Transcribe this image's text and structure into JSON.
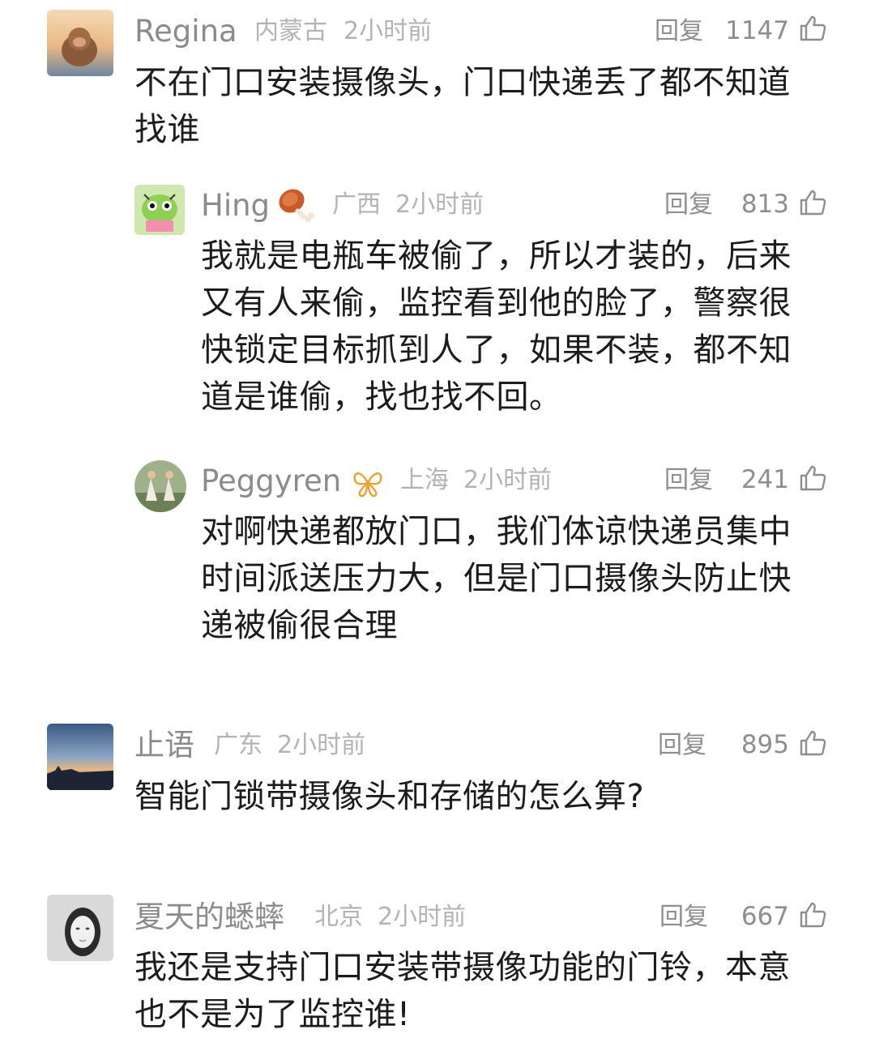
{
  "comments": [
    {
      "user": "Regina",
      "location": "内蒙古",
      "time": "2小时前",
      "reply_label": "回复",
      "likes": "1147",
      "text": "不在门口安装摄像头，门口快递丢了都不知道\n找谁",
      "avatar_icon": "photo-avatar-monkey"
    },
    {
      "user": "Hing",
      "location": "广西",
      "time": "2小时前",
      "reply_label": "回复",
      "likes": "813",
      "text": "我就是电瓶车被偷了，所以才装的，后来\n又有人来偷，监控看到他的脸了，警察很\n快锁定目标抓到人了，如果不装，都不知\n道是谁偷，找也找不回。",
      "avatar_icon": "cartoon-avatar",
      "badge_icon": "meat-drumstick-icon"
    },
    {
      "user": "Peggyren",
      "location": "上海",
      "time": "2小时前",
      "reply_label": "回复",
      "likes": "241",
      "text": "对啊快递都放门口，我们体谅快递员集中\n时间派送压力大，但是门口摄像头防止快\n递被偷很合理",
      "avatar_icon": "photo-avatar-girls",
      "badge_icon": "butterfly-vip-icon"
    },
    {
      "user": "止语",
      "location": "广东",
      "time": "2小时前",
      "reply_label": "回复",
      "likes": "895",
      "text": "智能门锁带摄像头和存储的怎么算?",
      "avatar_icon": "photo-avatar-sunset"
    },
    {
      "user": "夏天的蟋蟀",
      "location": "北京",
      "time": "2小时前",
      "reply_label": "回复",
      "likes": "667",
      "text": "我还是支持门口安装带摄像功能的门铃，本意\n也不是为了监控谁!",
      "avatar_icon": "photo-avatar-woman"
    }
  ],
  "like_icon": "thumbs-up-icon",
  "colors": {
    "name": "#8b8b8b",
    "meta": "#b3b3b3",
    "body": "#1c1c1c",
    "badge": "#f0a030"
  }
}
